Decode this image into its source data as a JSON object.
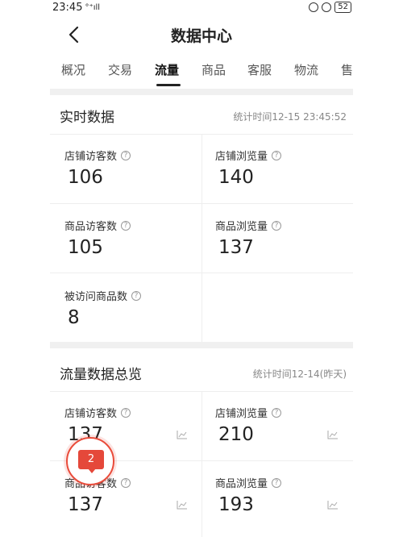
{
  "status_bar": {
    "time": "23:45",
    "signal": "°⁺ıll",
    "battery": "52"
  },
  "header": {
    "title": "数据中心"
  },
  "tabs": [
    {
      "label": "概况"
    },
    {
      "label": "交易"
    },
    {
      "label": "流量",
      "active": true
    },
    {
      "label": "商品"
    },
    {
      "label": "客服"
    },
    {
      "label": "物流"
    },
    {
      "label": "售"
    }
  ],
  "realtime": {
    "title": "实时数据",
    "time": "统计时间12-15 23:45:52",
    "cells": [
      {
        "label": "店铺访客数",
        "value": "106"
      },
      {
        "label": "店铺浏览量",
        "value": "140"
      },
      {
        "label": "商品访客数",
        "value": "105"
      },
      {
        "label": "商品浏览量",
        "value": "137"
      },
      {
        "label": "被访问商品数",
        "value": "8"
      }
    ]
  },
  "overview": {
    "title": "流量数据总览",
    "time": "统计时间12-14(昨天)",
    "cells": [
      {
        "label": "店铺访客数",
        "value": "137"
      },
      {
        "label": "店铺浏览量",
        "value": "210"
      },
      {
        "label": "商品访客数",
        "value": "137"
      },
      {
        "label": "商品浏览量",
        "value": "193"
      }
    ]
  },
  "float_badge": {
    "count": "2"
  },
  "colors": {
    "accent": "#e5483a",
    "divider": "#f0f0f0"
  }
}
